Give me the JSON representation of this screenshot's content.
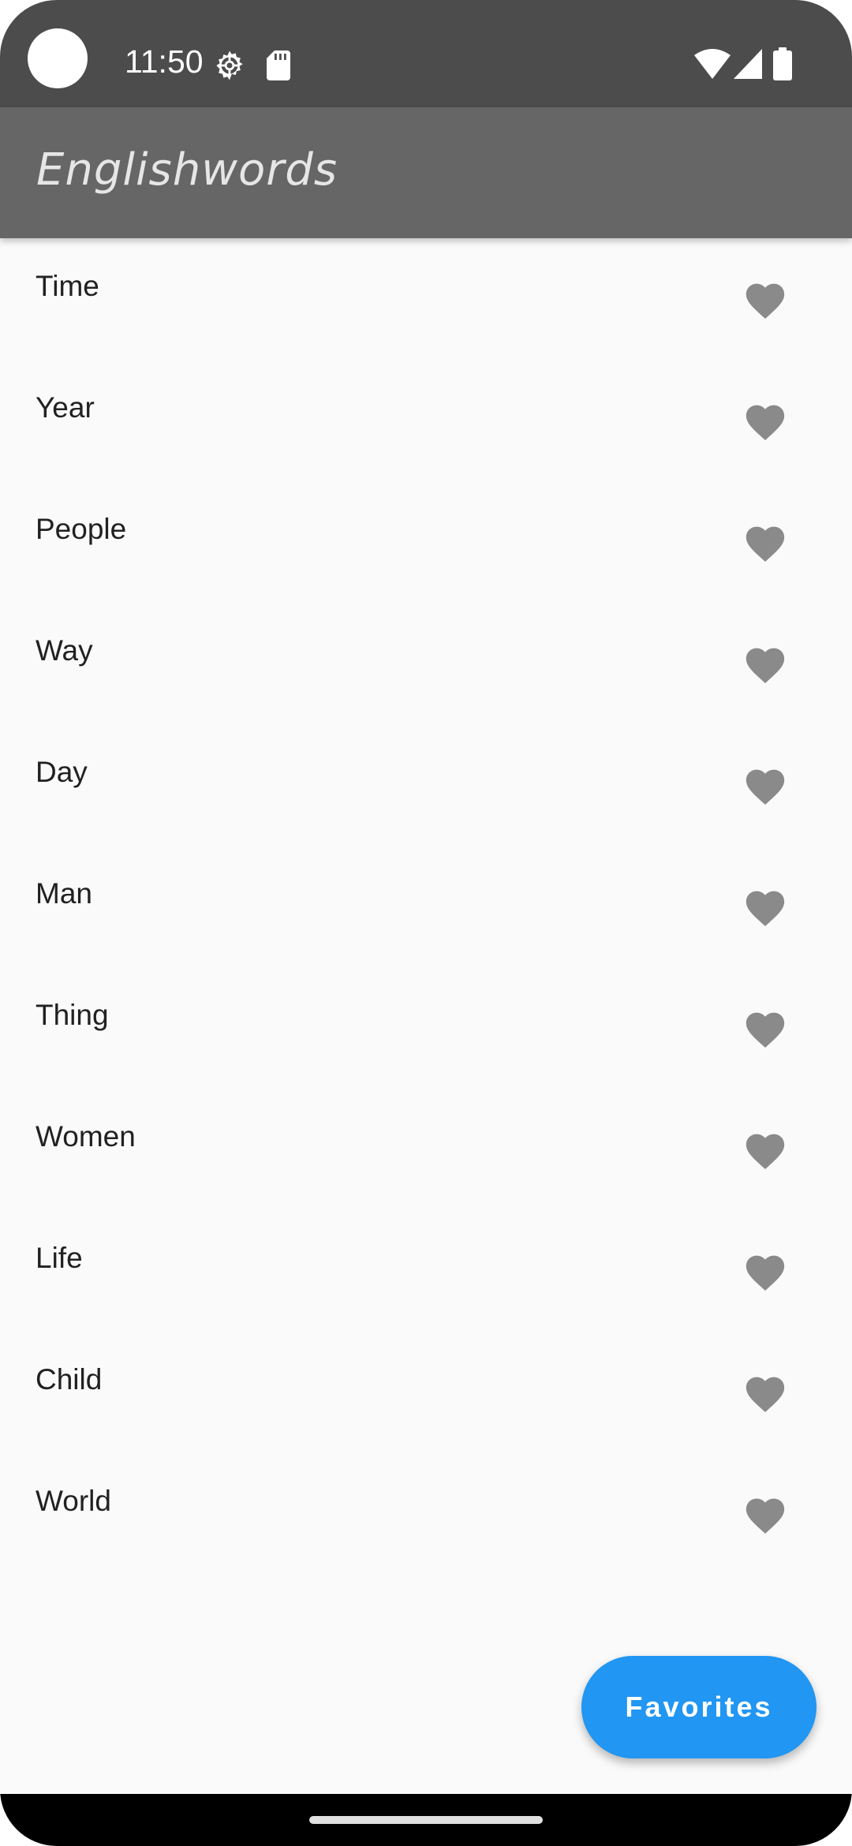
{
  "status_bar": {
    "time": "11:50",
    "icons": [
      "camera-dot",
      "gear-icon",
      "sd-card-icon",
      "wifi-icon",
      "signal-icon",
      "battery-icon"
    ]
  },
  "app_bar": {
    "title": "Englishwords"
  },
  "words": [
    {
      "label": "Time",
      "icon": "heart-icon"
    },
    {
      "label": "Year",
      "icon": "heart-icon"
    },
    {
      "label": "People",
      "icon": "heart-icon"
    },
    {
      "label": "Way",
      "icon": "heart-icon"
    },
    {
      "label": "Day",
      "icon": "heart-icon"
    },
    {
      "label": "Man",
      "icon": "heart-icon"
    },
    {
      "label": "Thing",
      "icon": "heart-icon"
    },
    {
      "label": "Women",
      "icon": "heart-icon"
    },
    {
      "label": "Life",
      "icon": "heart-icon"
    },
    {
      "label": "Child",
      "icon": "heart-icon"
    },
    {
      "label": "World",
      "icon": "heart-icon"
    }
  ],
  "fab": {
    "label": "Favorites"
  },
  "colors": {
    "status_bar": "#4c4c4c",
    "app_bar": "#666666",
    "background": "#fafafa",
    "heart": "#8a8a8a",
    "accent": "#2196f3",
    "nav_bar": "#000000"
  }
}
